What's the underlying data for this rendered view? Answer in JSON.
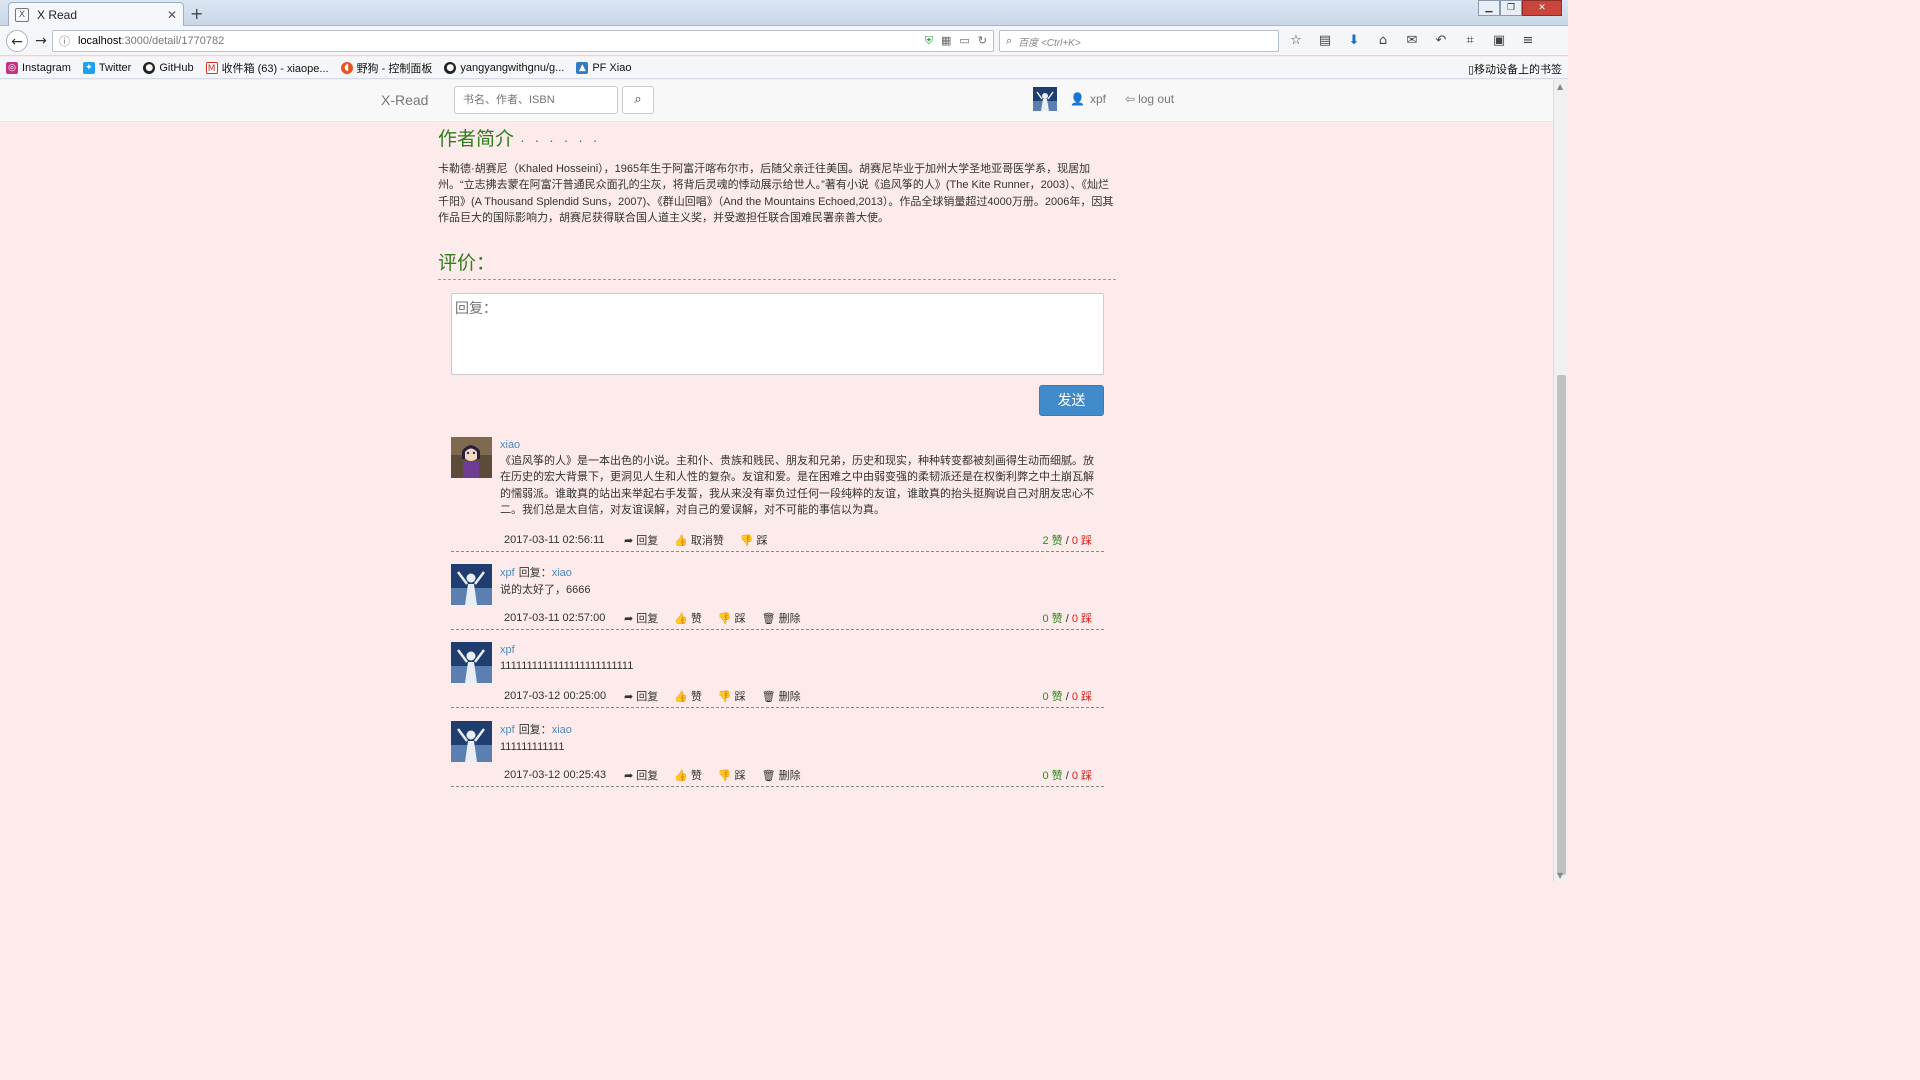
{
  "browser": {
    "tab_title": "X Read",
    "tab_favicon": "X",
    "url_host": "localhost",
    "url_path": ":3000/detail/1770782",
    "search_placeholder": "百度 <Ctrl+K>",
    "bookmarks": [
      {
        "label": "Instagram",
        "icon": "instagram-icon",
        "color": "#c13584"
      },
      {
        "label": "Twitter",
        "icon": "twitter-icon",
        "color": "#1da1f2"
      },
      {
        "label": "GitHub",
        "icon": "github-icon",
        "color": "#222222"
      },
      {
        "label": "收件箱 (63) - xiaope...",
        "icon": "gmail-icon",
        "color": "#d93025"
      },
      {
        "label": "野狗 - 控制面板",
        "icon": "wilddog-icon",
        "color": "#e8541e"
      },
      {
        "label": "yangyangwithgnu/g...",
        "icon": "github-icon",
        "color": "#222222"
      },
      {
        "label": "PF Xiao",
        "icon": "photo-icon",
        "color": "#2f7cc4"
      }
    ],
    "bookmarks_right": "移动设备上的书签"
  },
  "site": {
    "brand": "X-Read",
    "search_placeholder": "书名、作者、ISBN",
    "username": "xpf",
    "logout": "log out"
  },
  "author": {
    "heading": "作者简介",
    "dots": "· · · · · ·",
    "bio": "卡勒德·胡赛尼（Khaled Hosseini），1965年生于阿富汗喀布尔市，后随父亲迁往美国。胡赛尼毕业于加州大学圣地亚哥医学系，现居加州。“立志拂去蒙在阿富汗普通民众面孔的尘灰，将背后灵魂的悸动展示给世人。”著有小说《追风筝的人》(The Kite Runner，2003）、《灿烂千阳》(A Thousand Splendid Suns，2007)、《群山回唱》（And the Mountains Echoed,2013）。作品全球销量超过4000万册。2006年，因其作品巨大的国际影响力，胡赛尼获得联合国人道主义奖，并受邀担任联合国难民署亲善大使。"
  },
  "reviews": {
    "heading": "评价：",
    "reply_placeholder": "回复：",
    "send_label": "发送",
    "reply_to_label": "回复：",
    "vote_sep": " / ",
    "comments": [
      {
        "user": "xiao",
        "reply_to": "",
        "text": "《追风筝的人》是一本出色的小说。主和仆、贵族和贱民、朋友和兄弟，历史和现实，种种转变都被刻画得生动而细腻。放在历史的宏大背景下，更洞见人生和人性的复杂。友谊和爱。是在困难之中由弱变强的柔韧派还是在权衡利弊之中土崩瓦解的懦弱派。谁敢真的站出来举起右手发誓，我从来没有辜负过任何一段纯粹的友谊，谁敢真的抬头挺胸说自己对朋友忠心不二。我们总是太自信，对友谊误解，对自己的爱误解，对不可能的事信以为真。",
        "time": "2017-03-11 02:56:11",
        "reply": "回复",
        "like": "取消赞",
        "dislike": "踩",
        "delete": "",
        "likes": "2 赞",
        "dislikes": "0 踩"
      },
      {
        "user": "xpf",
        "reply_to": "xiao",
        "text": "说的太好了，6666",
        "time": "2017-03-11 02:57:00",
        "reply": "回复",
        "like": "赞",
        "dislike": "踩",
        "delete": "删除",
        "likes": "0 赞",
        "dislikes": "0 踩"
      },
      {
        "user": "xpf",
        "reply_to": "",
        "text": "1111111111111111111111111",
        "time": "2017-03-12 00:25:00",
        "reply": "回复",
        "like": "赞",
        "dislike": "踩",
        "delete": "删除",
        "likes": "0 赞",
        "dislikes": "0 踩"
      },
      {
        "user": "xpf",
        "reply_to": "xiao",
        "text": "111111111111",
        "time": "2017-03-12 00:25:43",
        "reply": "回复",
        "like": "赞",
        "dislike": "踩",
        "delete": "删除",
        "likes": "0 赞",
        "dislikes": "0 踩"
      }
    ]
  }
}
